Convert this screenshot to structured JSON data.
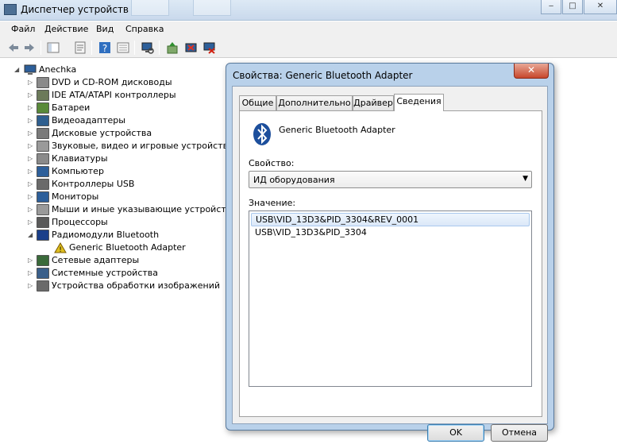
{
  "window": {
    "title": "Диспетчер устройств",
    "controls": [
      "‒",
      "□",
      "✕"
    ]
  },
  "menu": [
    "Файл",
    "Действие",
    "Вид",
    "Справка"
  ],
  "toolbar": {
    "icons": [
      "back-arrow-icon",
      "forward-arrow-icon",
      "show-tree-icon",
      "properties-icon",
      "help-icon",
      "view-icon",
      "scan-hardware-icon",
      "update-driver-icon",
      "disable-device-icon",
      "uninstall-device-icon"
    ]
  },
  "tree": {
    "root": "Anechka",
    "items": [
      {
        "label": "DVD и CD-ROM дисководы",
        "icon": "dvd-drive-icon",
        "color": "#8a8a8a"
      },
      {
        "label": "IDE ATA/ATAPI контроллеры",
        "icon": "ide-controller-icon",
        "color": "#6c7a5a"
      },
      {
        "label": "Батареи",
        "icon": "battery-icon",
        "color": "#5a8a3a"
      },
      {
        "label": "Видеоадаптеры",
        "icon": "display-adapter-icon",
        "color": "#2f5f8f"
      },
      {
        "label": "Дисковые устройства",
        "icon": "disk-drive-icon",
        "color": "#7a7a7a"
      },
      {
        "label": "Звуковые, видео и игровые устройства",
        "icon": "sound-device-icon",
        "color": "#9a9a9a"
      },
      {
        "label": "Клавиатуры",
        "icon": "keyboard-icon",
        "color": "#8a8a8a"
      },
      {
        "label": "Компьютер",
        "icon": "computer-icon",
        "color": "#2d5f9a"
      },
      {
        "label": "Контроллеры USB",
        "icon": "usb-icon",
        "color": "#6a6a6a"
      },
      {
        "label": "Мониторы",
        "icon": "monitor-icon",
        "color": "#2d5f9a"
      },
      {
        "label": "Мыши и иные указывающие устройства",
        "icon": "mouse-icon",
        "color": "#9a9a9a"
      },
      {
        "label": "Процессоры",
        "icon": "processor-icon",
        "color": "#5a5a5a"
      },
      {
        "label": "Радиомодули Bluetooth",
        "icon": "bluetooth-icon",
        "color": "#1a3f8a"
      },
      {
        "label": "Generic Bluetooth Adapter",
        "icon": "warning-bluetooth-icon",
        "color": "#e0c020",
        "child": true
      },
      {
        "label": "Сетевые адаптеры",
        "icon": "network-adapter-icon",
        "color": "#3a6a3a"
      },
      {
        "label": "Системные устройства",
        "icon": "system-device-icon",
        "color": "#3a5f8a"
      },
      {
        "label": "Устройства обработки изображений",
        "icon": "imaging-device-icon",
        "color": "#6a6a6a"
      }
    ]
  },
  "dialog": {
    "title": "Свойства: Generic Bluetooth Adapter",
    "close": "✕",
    "tabs": [
      "Общие",
      "Дополнительно",
      "Драйвер",
      "Сведения"
    ],
    "active_tab": "Сведения",
    "device_name": "Generic Bluetooth Adapter",
    "property_label": "Свойство:",
    "property_value": "ИД оборудования",
    "value_label": "Значение:",
    "values": [
      "USB\\VID_13D3&PID_3304&REV_0001",
      "USB\\VID_13D3&PID_3304"
    ],
    "ok": "OK",
    "cancel": "Отмена"
  }
}
